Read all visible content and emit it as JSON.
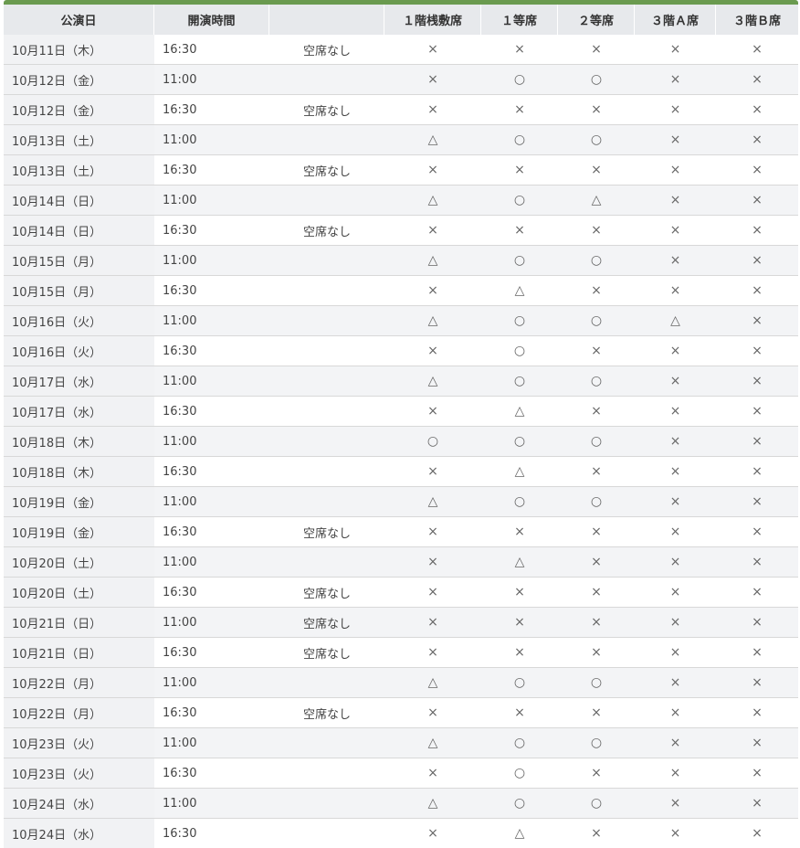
{
  "headers": [
    "公演日",
    "開演時間",
    "",
    "１階桟敷席",
    "１等席",
    "２等席",
    "３階Ａ席",
    "３階Ｂ席"
  ],
  "rows": [
    {
      "date": "10月11日（木）",
      "time": "16:30",
      "note": "空席なし",
      "seats": [
        "×",
        "×",
        "×",
        "×",
        "×"
      ]
    },
    {
      "date": "10月12日（金）",
      "time": "11:00",
      "note": "",
      "seats": [
        "×",
        "○",
        "○",
        "×",
        "×"
      ]
    },
    {
      "date": "10月12日（金）",
      "time": "16:30",
      "note": "空席なし",
      "seats": [
        "×",
        "×",
        "×",
        "×",
        "×"
      ]
    },
    {
      "date": "10月13日（土）",
      "time": "11:00",
      "note": "",
      "seats": [
        "△",
        "○",
        "○",
        "×",
        "×"
      ]
    },
    {
      "date": "10月13日（土）",
      "time": "16:30",
      "note": "空席なし",
      "seats": [
        "×",
        "×",
        "×",
        "×",
        "×"
      ]
    },
    {
      "date": "10月14日（日）",
      "time": "11:00",
      "note": "",
      "seats": [
        "△",
        "○",
        "△",
        "×",
        "×"
      ]
    },
    {
      "date": "10月14日（日）",
      "time": "16:30",
      "note": "空席なし",
      "seats": [
        "×",
        "×",
        "×",
        "×",
        "×"
      ]
    },
    {
      "date": "10月15日（月）",
      "time": "11:00",
      "note": "",
      "seats": [
        "△",
        "○",
        "○",
        "×",
        "×"
      ]
    },
    {
      "date": "10月15日（月）",
      "time": "16:30",
      "note": "",
      "seats": [
        "×",
        "△",
        "×",
        "×",
        "×"
      ]
    },
    {
      "date": "10月16日（火）",
      "time": "11:00",
      "note": "",
      "seats": [
        "△",
        "○",
        "○",
        "△",
        "×"
      ]
    },
    {
      "date": "10月16日（火）",
      "time": "16:30",
      "note": "",
      "seats": [
        "×",
        "○",
        "×",
        "×",
        "×"
      ]
    },
    {
      "date": "10月17日（水）",
      "time": "11:00",
      "note": "",
      "seats": [
        "△",
        "○",
        "○",
        "×",
        "×"
      ]
    },
    {
      "date": "10月17日（水）",
      "time": "16:30",
      "note": "",
      "seats": [
        "×",
        "△",
        "×",
        "×",
        "×"
      ]
    },
    {
      "date": "10月18日（木）",
      "time": "11:00",
      "note": "",
      "seats": [
        "○",
        "○",
        "○",
        "×",
        "×"
      ]
    },
    {
      "date": "10月18日（木）",
      "time": "16:30",
      "note": "",
      "seats": [
        "×",
        "△",
        "×",
        "×",
        "×"
      ]
    },
    {
      "date": "10月19日（金）",
      "time": "11:00",
      "note": "",
      "seats": [
        "△",
        "○",
        "○",
        "×",
        "×"
      ]
    },
    {
      "date": "10月19日（金）",
      "time": "16:30",
      "note": "空席なし",
      "seats": [
        "×",
        "×",
        "×",
        "×",
        "×"
      ]
    },
    {
      "date": "10月20日（土）",
      "time": "11:00",
      "note": "",
      "seats": [
        "×",
        "△",
        "×",
        "×",
        "×"
      ]
    },
    {
      "date": "10月20日（土）",
      "time": "16:30",
      "note": "空席なし",
      "seats": [
        "×",
        "×",
        "×",
        "×",
        "×"
      ]
    },
    {
      "date": "10月21日（日）",
      "time": "11:00",
      "note": "空席なし",
      "seats": [
        "×",
        "×",
        "×",
        "×",
        "×"
      ]
    },
    {
      "date": "10月21日（日）",
      "time": "16:30",
      "note": "空席なし",
      "seats": [
        "×",
        "×",
        "×",
        "×",
        "×"
      ]
    },
    {
      "date": "10月22日（月）",
      "time": "11:00",
      "note": "",
      "seats": [
        "△",
        "○",
        "○",
        "×",
        "×"
      ]
    },
    {
      "date": "10月22日（月）",
      "time": "16:30",
      "note": "空席なし",
      "seats": [
        "×",
        "×",
        "×",
        "×",
        "×"
      ]
    },
    {
      "date": "10月23日（火）",
      "time": "11:00",
      "note": "",
      "seats": [
        "△",
        "○",
        "○",
        "×",
        "×"
      ]
    },
    {
      "date": "10月23日（火）",
      "time": "16:30",
      "note": "",
      "seats": [
        "×",
        "○",
        "×",
        "×",
        "×"
      ]
    },
    {
      "date": "10月24日（水）",
      "time": "11:00",
      "note": "",
      "seats": [
        "△",
        "○",
        "○",
        "×",
        "×"
      ]
    },
    {
      "date": "10月24日（水）",
      "time": "16:30",
      "note": "",
      "seats": [
        "×",
        "△",
        "×",
        "×",
        "×"
      ]
    }
  ]
}
